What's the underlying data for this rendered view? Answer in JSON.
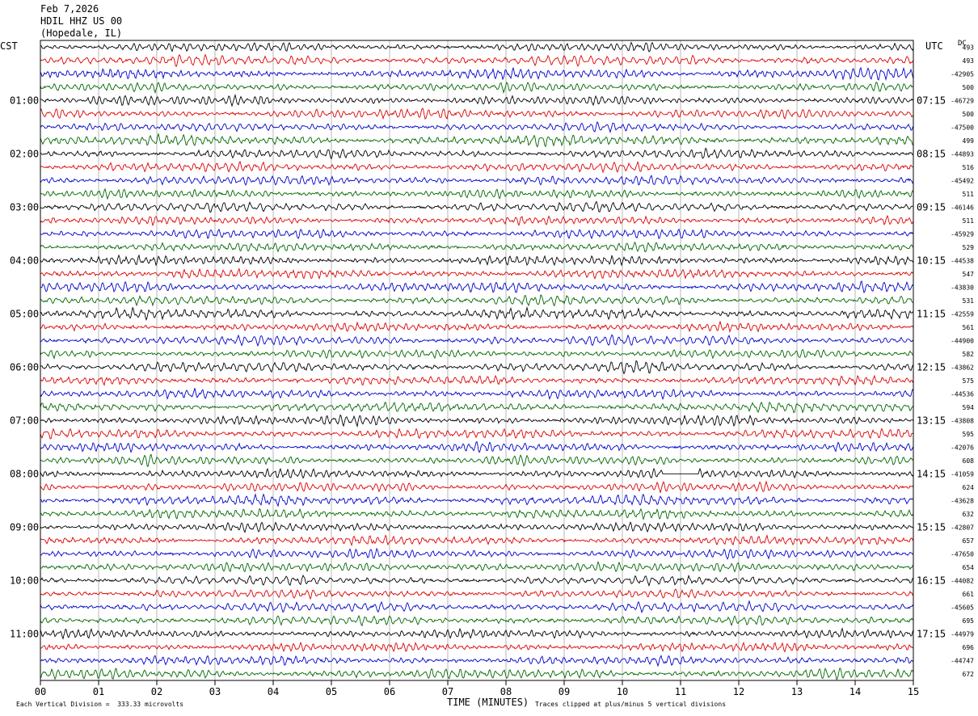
{
  "header": {
    "date": "Feb 7,2026",
    "station": "HDIL HHZ US 00",
    "location": "(Hopedale, IL)"
  },
  "left_zone": "CST",
  "right_zone": "UTC",
  "dc_label": "DC",
  "footer": {
    "scale_note": "Each Vertical Division =  333.33 microvolts",
    "xlabel": "TIME (MINUTES)",
    "clip_note": "Traces clipped at plus/minus 5 vertical divisions"
  },
  "colors": {
    "trace_cycle": [
      "#000000",
      "#dd0000",
      "#0000cc",
      "#006600"
    ],
    "gridline": "#888888"
  },
  "chart_data": {
    "type": "line",
    "title": "HDIL HHZ US 00",
    "xlabel": "TIME (MINUTES)",
    "xlim": [
      0,
      15
    ],
    "x_ticks": [
      "00",
      "01",
      "02",
      "03",
      "04",
      "05",
      "06",
      "07",
      "08",
      "09",
      "10",
      "11",
      "12",
      "13",
      "14",
      "15"
    ],
    "trace_count": 48,
    "minutes_per_trace": 15,
    "left_hour_labels": [
      "01:00",
      "02:00",
      "03:00",
      "04:00",
      "05:00",
      "06:00",
      "07:00",
      "08:00",
      "09:00",
      "10:00",
      "11:00"
    ],
    "right_hour_labels": [
      "07:15",
      "08:15",
      "09:15",
      "10:15",
      "11:15",
      "12:15",
      "13:15",
      "14:15",
      "15:15",
      "16:15",
      "17:15"
    ],
    "dc_offsets": [
      "493",
      "493",
      "-42905",
      "500",
      "-46729",
      "500",
      "-47500",
      "499",
      "-44893",
      "516",
      "-45492",
      "511",
      "-46146",
      "511",
      "-45929",
      "529",
      "-44538",
      "547",
      "-43830",
      "531",
      "-42559",
      "561",
      "-44900",
      "582",
      "-43862",
      "575",
      "-44536",
      "594",
      "-43808",
      "595",
      "-42076",
      "608",
      "-41059",
      "624",
      "-43628",
      "632",
      "-42807",
      "657",
      "-47650",
      "654",
      "-44082",
      "661",
      "-45605",
      "695",
      "-44979",
      "696",
      "-44747",
      "672"
    ],
    "clipped_segment": {
      "trace_index": 32,
      "start_minute": 10.7,
      "end_minute": 11.3
    }
  }
}
